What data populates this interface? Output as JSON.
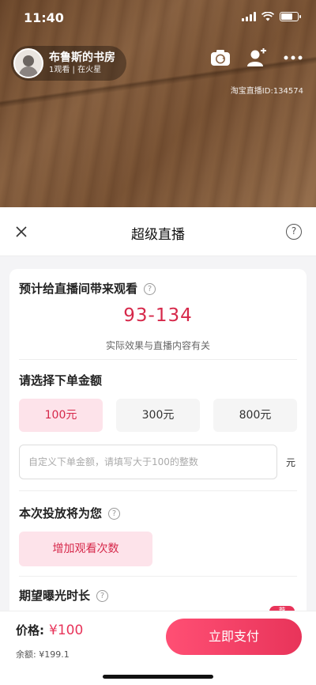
{
  "status_bar": {
    "time": "11:40"
  },
  "anchor": {
    "name": "布鲁斯的书房",
    "sub": "1观看 | 在火星"
  },
  "live_id": "淘宝直播ID:134574",
  "sheet": {
    "title": "超级直播",
    "help_glyph": "?"
  },
  "estimate": {
    "title": "预计给直播间带来观看",
    "range": "93-134",
    "note": "实际效果与直播内容有关"
  },
  "amount": {
    "title": "请选择下单金额",
    "options": [
      "100元",
      "300元",
      "800元"
    ],
    "selected": "100元",
    "custom_placeholder": "自定义下单金额，请填写大于100的整数",
    "unit": "元"
  },
  "goal": {
    "title": "本次投放将为您",
    "option": "增加观看次数"
  },
  "duration": {
    "title": "期望曝光时长",
    "tag": "荐"
  },
  "footer": {
    "price_label": "价格:",
    "price_value": "¥100",
    "balance": "余额: ¥199.1",
    "pay_button": "立即支付"
  },
  "colors": {
    "accent": "#e8345a",
    "accent_light": "#fde3ea"
  }
}
